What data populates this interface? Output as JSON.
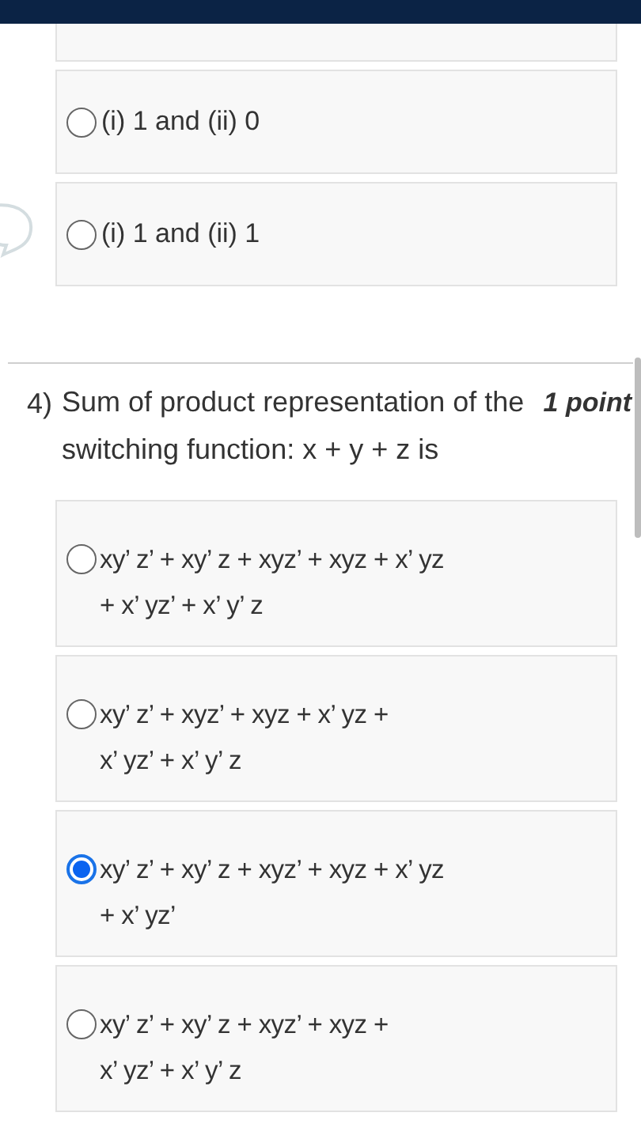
{
  "previous_question": {
    "options": [
      {
        "label": "(i) 1 and (ii) 0",
        "selected": false
      },
      {
        "label": "(i) 1 and (ii) 1",
        "selected": false
      }
    ]
  },
  "question": {
    "number": "4)",
    "text": "Sum of product representation of the switching function: x + y + z is",
    "points": "1 point",
    "options": [
      {
        "lines": [
          "xy’ z’ + xy’ z + xyz’ + xyz + x’ yz",
          "+ x’ yz’ + x’ y’ z"
        ],
        "selected": false
      },
      {
        "lines": [
          "xy’ z’ + xyz’ + xyz + x’ yz +",
          "x’ yz’ + x’ y’ z"
        ],
        "selected": false
      },
      {
        "lines": [
          "xy’ z’ + xy’ z + xyz’ + xyz + x’ yz",
          "+ x’ yz’"
        ],
        "selected": true
      },
      {
        "lines": [
          "xy’ z’ + xy’ z + xyz’ + xyz +",
          "x’ yz’ + x’ y’ z"
        ],
        "selected": false
      }
    ]
  }
}
